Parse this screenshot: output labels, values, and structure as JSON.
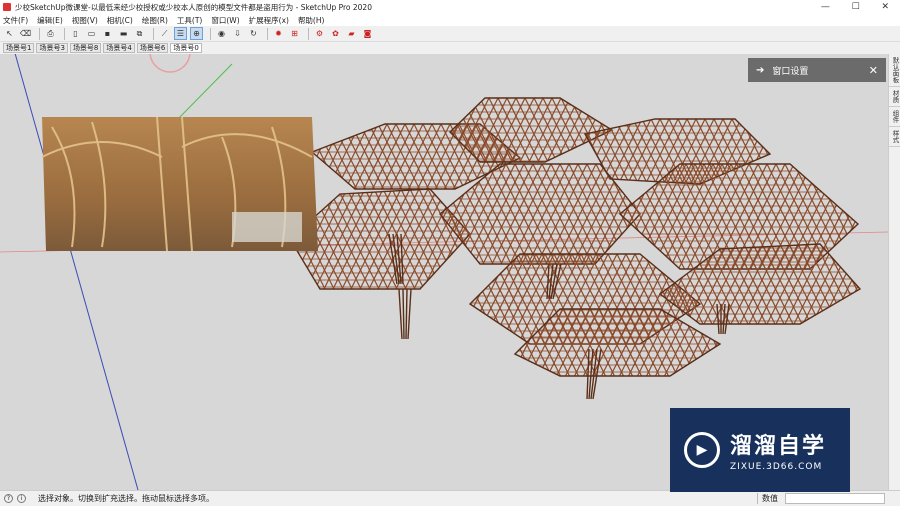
{
  "window": {
    "title": "少校SketchUp微课堂-以最低来经少校授权或少校本人原创的模型文件都是盗用行为 - SketchUp Pro 2020",
    "controls": [
      "—",
      "☐",
      "✕"
    ]
  },
  "menubar": [
    "文件(F)",
    "编辑(E)",
    "视图(V)",
    "相机(C)",
    "绘图(R)",
    "工具(T)",
    "窗口(W)",
    "扩展程序(x)",
    "帮助(H)"
  ],
  "scenes": [
    "场景号1",
    "场景号3",
    "场景号8",
    "场景号4",
    "场景号6",
    "场景号0"
  ],
  "active_scene_index": 5,
  "tray": {
    "title": "窗口设置",
    "pin_icon": "➔",
    "close_icon": "✕"
  },
  "right_rail": [
    "默认面板",
    "材质",
    "组件",
    "样式"
  ],
  "status": {
    "message": "选择对象。切换到扩充选择。拖动鼠标选择多项。",
    "measure_label": "数值"
  },
  "watermark": {
    "main": "溜溜自学",
    "sub": "ZIXUE.3D66.COM"
  },
  "colors": {
    "viewport_bg": "#d7d7d7",
    "lattice": "#8a4a2a",
    "tray_bg": "#6b6b6b",
    "watermark_bg": "#17305c"
  }
}
